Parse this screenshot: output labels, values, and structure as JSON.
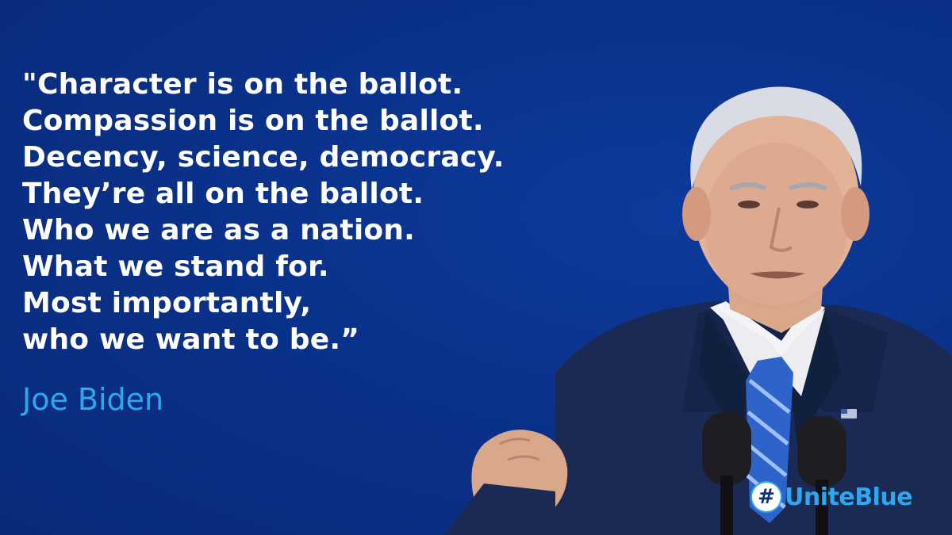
{
  "quote": {
    "lines": [
      "\"Character is on the ballot.",
      "Compassion is on the ballot.",
      "Decency, science, democracy.",
      "They’re all on the ballot.",
      "Who we are as a nation.",
      "What we stand for.",
      "Most importantly,",
      "who we want to be.”"
    ]
  },
  "author": "Joe Biden",
  "hashtag": {
    "icon": "hash-icon",
    "text": "UniteBlue"
  },
  "colors": {
    "background": "#0a3087",
    "quote_text": "#ffffff",
    "accent": "#2fa7ee"
  }
}
